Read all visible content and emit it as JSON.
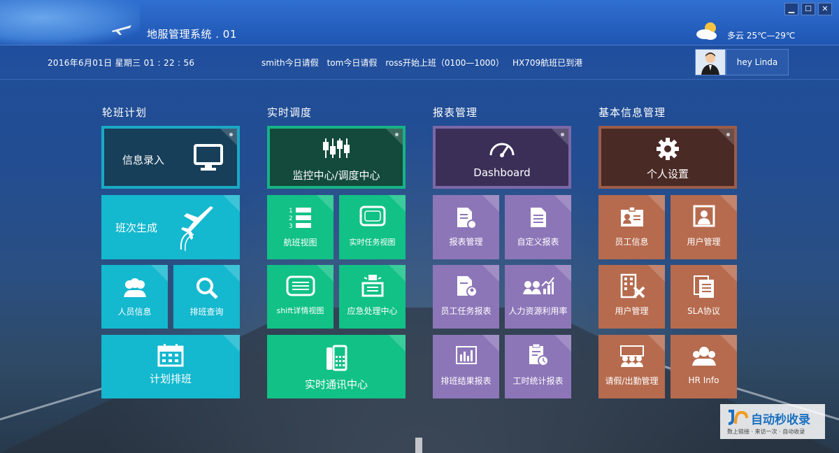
{
  "app": {
    "title": "地服管理系统 . 01"
  },
  "window_controls": {
    "minimize": "▁",
    "maximize": "☐",
    "close": "✕"
  },
  "weather": {
    "text": "多云 25℃—29℃",
    "icon": "partly-cloudy-icon"
  },
  "infobar": {
    "datetime": "2016年6月01日 星期三  01 : 22 : 56",
    "notices": [
      "smith今日请假",
      "tom今日请假",
      "ross开始上班（0100—1000）",
      "HX709航班已到港"
    ],
    "user_greeting": "hey Linda"
  },
  "sections": {
    "shift_plan": {
      "title": "轮班计划",
      "tiles": {
        "info_entry": "信息录入",
        "shift_generate": "班次生成",
        "staff_info": "人员信息",
        "schedule_query": "排班查询",
        "plan_schedule": "计划排班"
      }
    },
    "dispatch": {
      "title": "实时调度",
      "tiles": {
        "monitor_center": "监控中心/调度中心",
        "flight_view": "航班视图",
        "task_view": "实时任务视图",
        "shift_detail": "shift详情视图",
        "emergency": "应急处理中心",
        "comm_center": "实时通讯中心"
      }
    },
    "reports": {
      "title": "报表管理",
      "tiles": {
        "dashboard": "Dashboard",
        "report_mgmt": "报表管理",
        "custom_report": "自定义报表",
        "staff_task_report": "员工任务报表",
        "hr_usage": "人力资源利用率",
        "shift_result_report": "排班结果报表",
        "hours_report": "工时统计报表"
      }
    },
    "basic_info": {
      "title": "基本信息管理",
      "tiles": {
        "personal_settings": "个人设置",
        "employee_info": "员工信息",
        "user_mgmt_1": "用户管理",
        "user_mgmt_2": "用户管理",
        "sla": "SLA协议",
        "leave_attendance": "请假/出勤管理",
        "hr_info": "HR Info"
      }
    }
  },
  "watermark": {
    "main": "自动秒收录",
    "sub": "数上链接 · 来访一次 · 自动收录"
  },
  "colors": {
    "teal": "#14b8cf",
    "green": "#11c186",
    "purple": "#8d76b8",
    "orange": "#b66b4e",
    "title_bar": "#1f56b3"
  }
}
